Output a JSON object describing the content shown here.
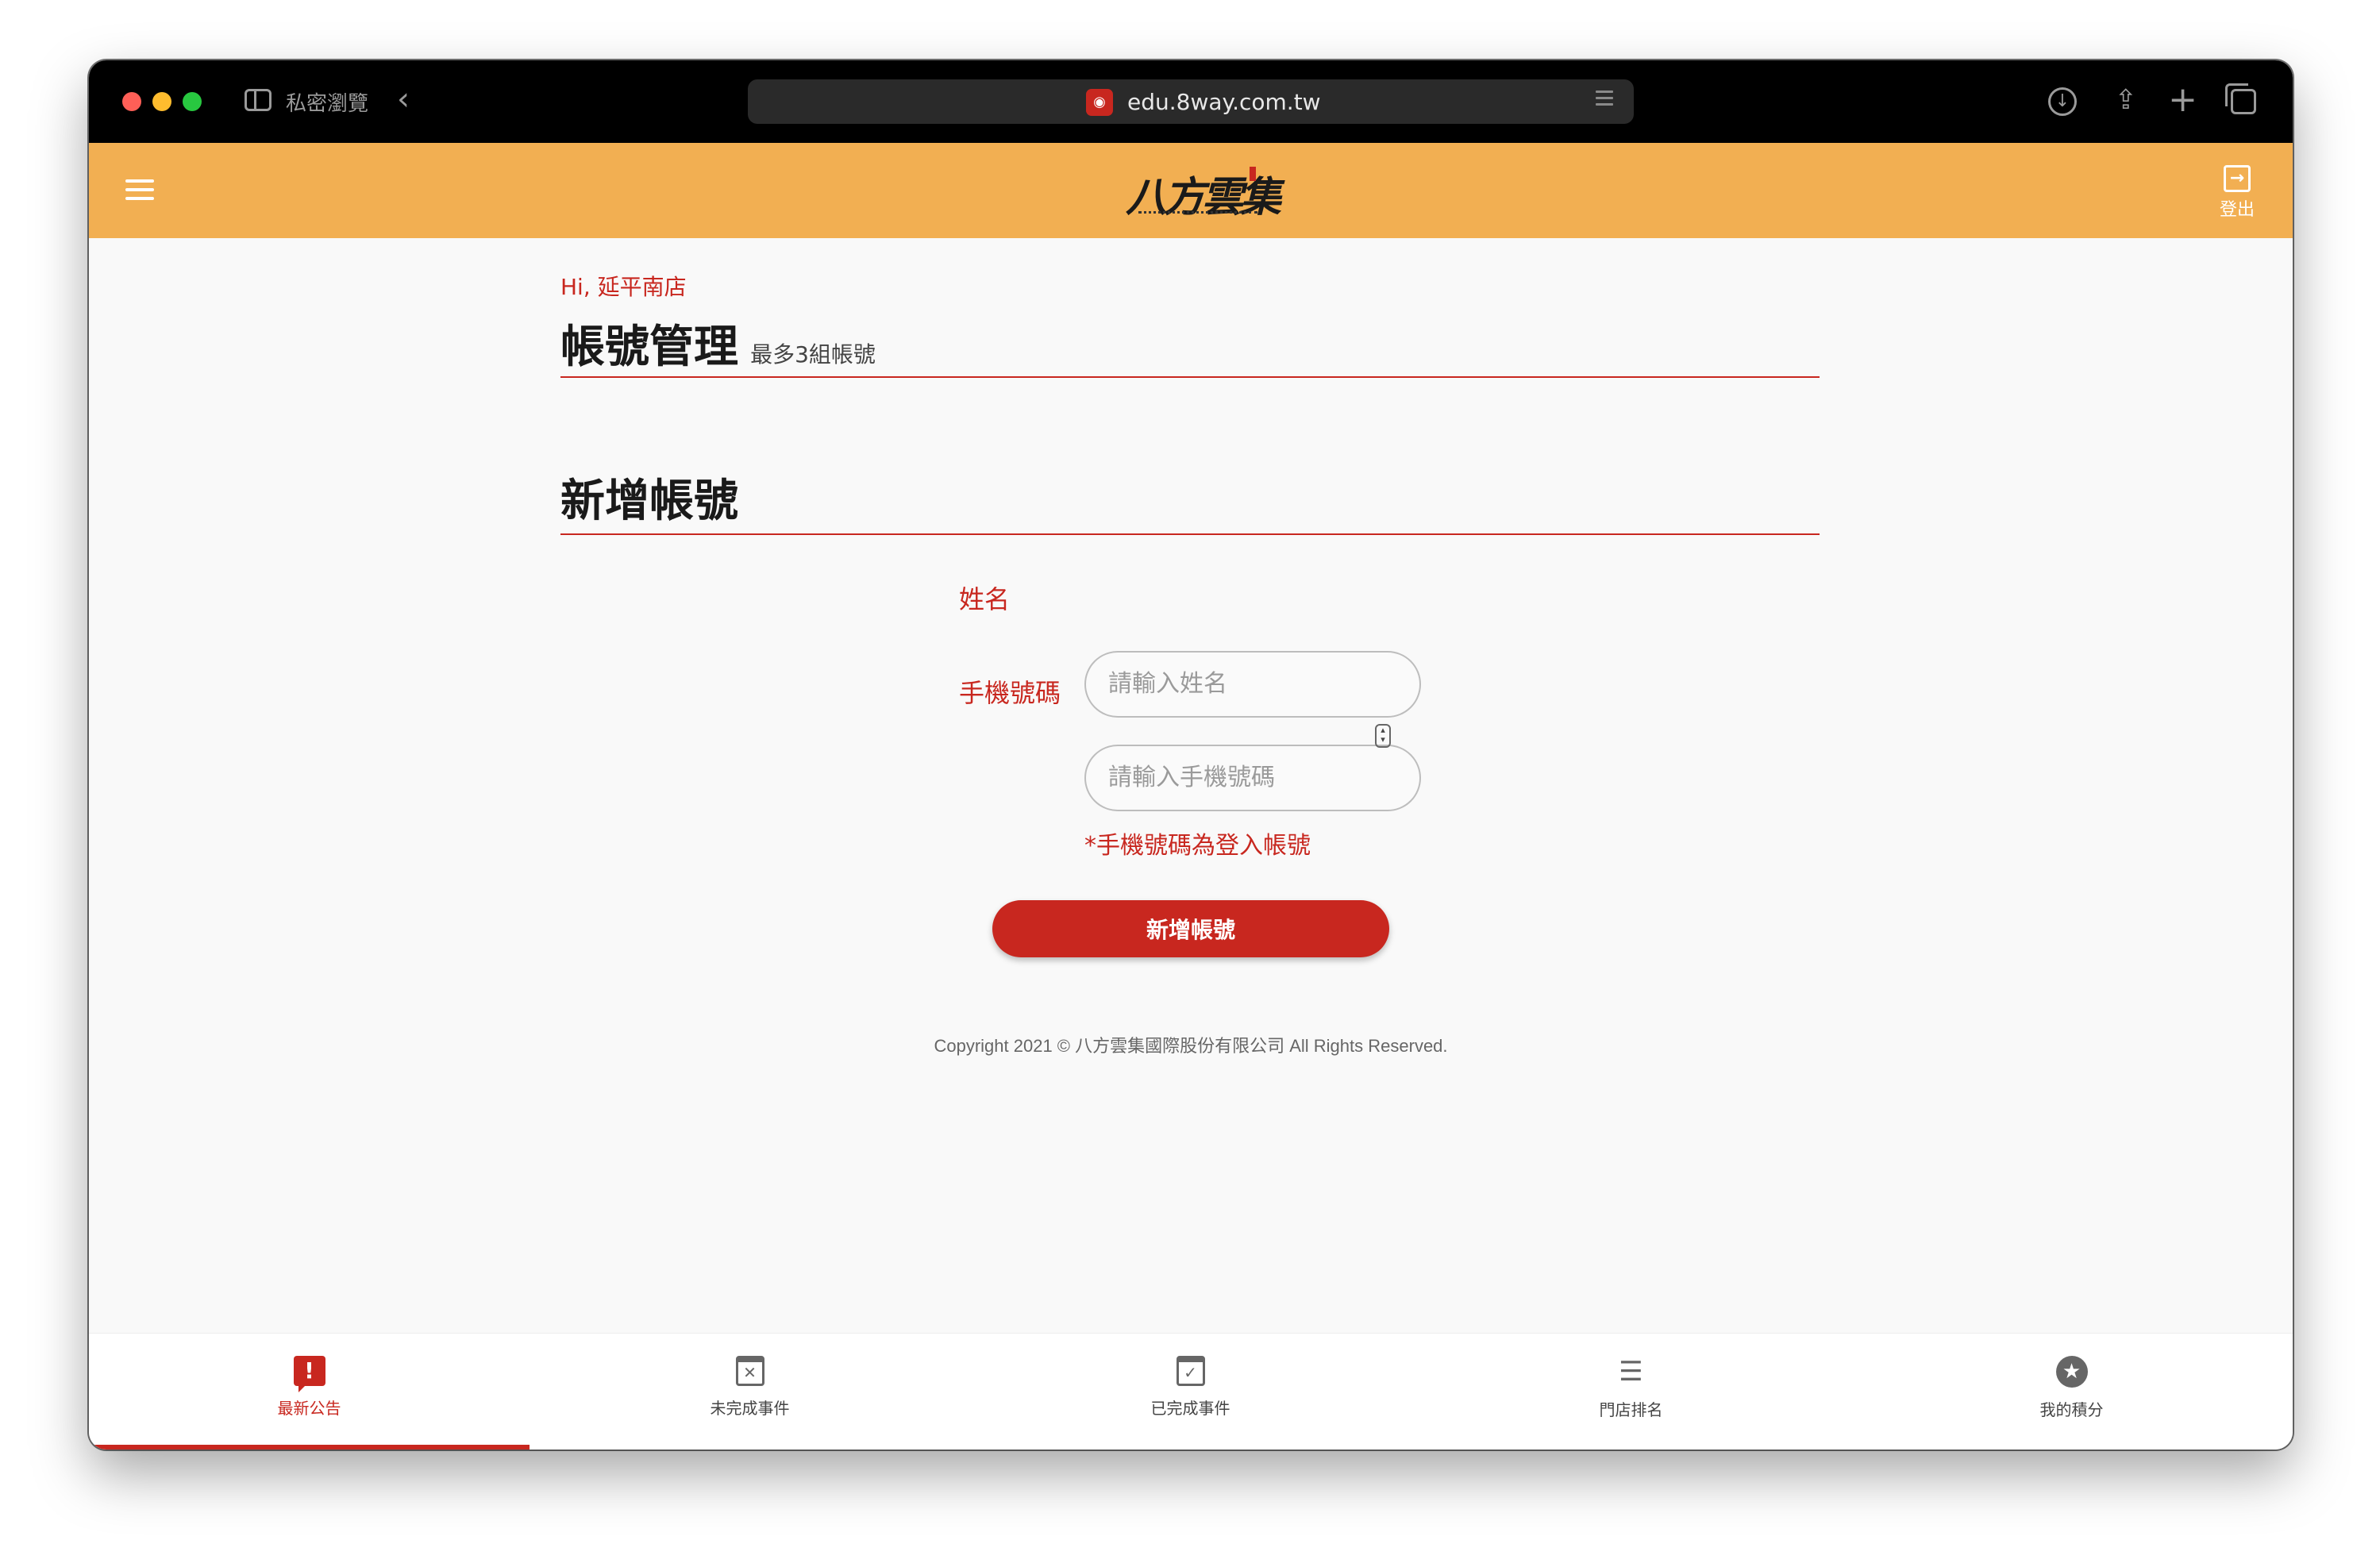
{
  "browser": {
    "private_label": "私密瀏覽",
    "url": "edu.8way.com.tw"
  },
  "header": {
    "logo_text": "八方雲集",
    "logout_label": "登出",
    "brand_color": "#f2af52"
  },
  "main": {
    "greeting": "Hi, 延平南店",
    "page_title": "帳號管理",
    "page_subtitle": "最多3組帳號",
    "section_title": "新增帳號",
    "form": {
      "name_label": "姓名",
      "name_placeholder": "請輸入姓名",
      "phone_label": "手機號碼",
      "phone_placeholder": "請輸入手機號碼",
      "phone_hint": "*手機號碼為登入帳號",
      "submit_label": "新增帳號"
    },
    "accent_color": "#c8271f"
  },
  "footer": {
    "copyright": "Copyright 2021 © 八方雲集國際股份有限公司 All Rights Reserved."
  },
  "bottom_nav": {
    "items": [
      {
        "label": "最新公告",
        "icon": "alert-icon",
        "active": true
      },
      {
        "label": "未完成事件",
        "icon": "calendar-x-icon",
        "active": false
      },
      {
        "label": "已完成事件",
        "icon": "calendar-check-icon",
        "active": false
      },
      {
        "label": "門店排名",
        "icon": "ranked-list-icon",
        "active": false
      },
      {
        "label": "我的積分",
        "icon": "star-icon",
        "active": false
      }
    ]
  }
}
